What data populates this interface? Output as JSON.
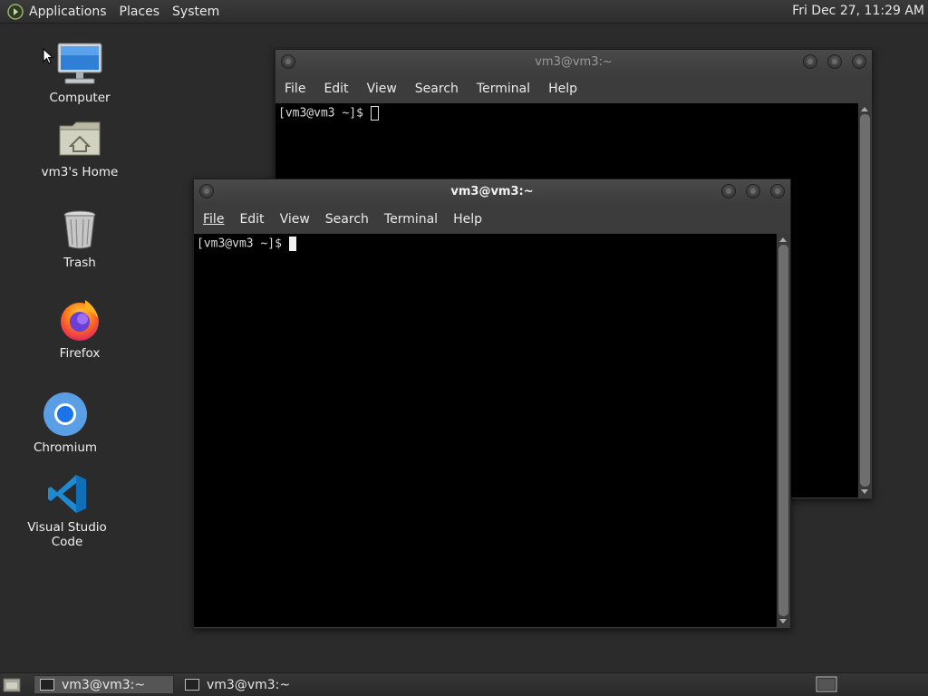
{
  "top_panel": {
    "menus": [
      "Applications",
      "Places",
      "System"
    ],
    "clock": "Fri Dec 27, 11:29 AM"
  },
  "desktop_icons": [
    {
      "label": "Computer",
      "icon": "computer-icon"
    },
    {
      "label": "vm3's Home",
      "icon": "home-folder-icon"
    },
    {
      "label": "Trash",
      "icon": "trash-icon"
    },
    {
      "label": "Firefox",
      "icon": "firefox-icon"
    },
    {
      "label": "Chromium",
      "icon": "chromium-icon"
    },
    {
      "label": "Visual Studio Code",
      "icon": "vscode-icon"
    }
  ],
  "windows": [
    {
      "title": "vm3@vm3:~",
      "menu": [
        "File",
        "Edit",
        "View",
        "Search",
        "Terminal",
        "Help"
      ],
      "prompt": "[vm3@vm3 ~]$ ",
      "focused": false
    },
    {
      "title": "vm3@vm3:~",
      "menu": [
        "File",
        "Edit",
        "View",
        "Search",
        "Terminal",
        "Help"
      ],
      "prompt": "[vm3@vm3 ~]$ ",
      "focused": true
    }
  ],
  "taskbar": {
    "tasks": [
      {
        "label": "vm3@vm3:~",
        "active": true
      },
      {
        "label": "vm3@vm3:~",
        "active": false
      }
    ]
  }
}
